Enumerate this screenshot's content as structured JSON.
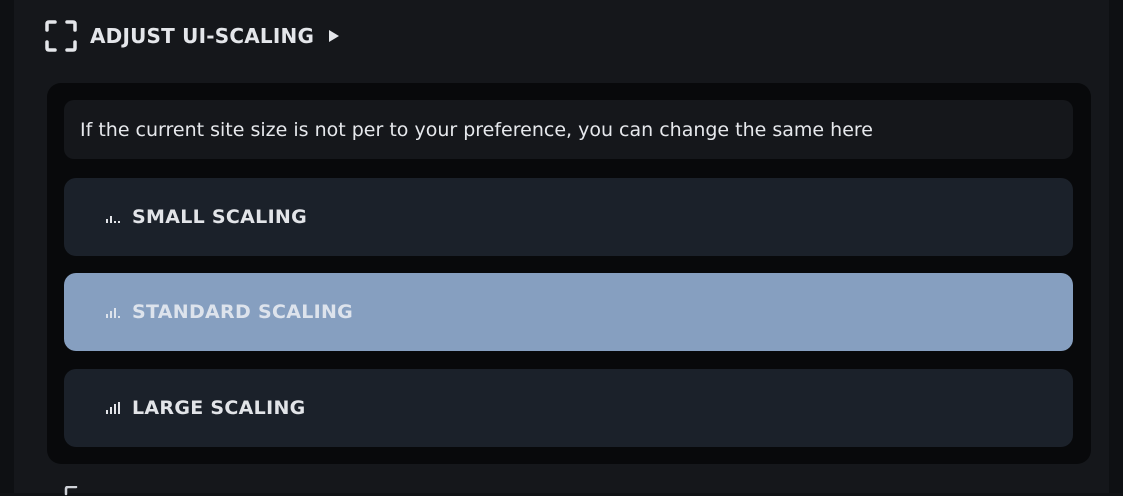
{
  "section": {
    "title": "ADJUST UI-SCALING",
    "icon": "expand-icon",
    "toggle_icon": "play-triangle-icon"
  },
  "info": {
    "text": "If the current site size is not per to your preference, you can change the same here"
  },
  "options": [
    {
      "label": "SMALL SCALING",
      "icon": "signal-bars-small-icon",
      "selected": false
    },
    {
      "label": "STANDARD SCALING",
      "icon": "signal-bars-medium-icon",
      "selected": true
    },
    {
      "label": "LARGE SCALING",
      "icon": "signal-bars-large-icon",
      "selected": false
    }
  ],
  "colors": {
    "panel_bg": "#15171b",
    "option_bg": "#1b212a",
    "selected_bg": "#869fc0",
    "text": "#e2e4e8"
  }
}
